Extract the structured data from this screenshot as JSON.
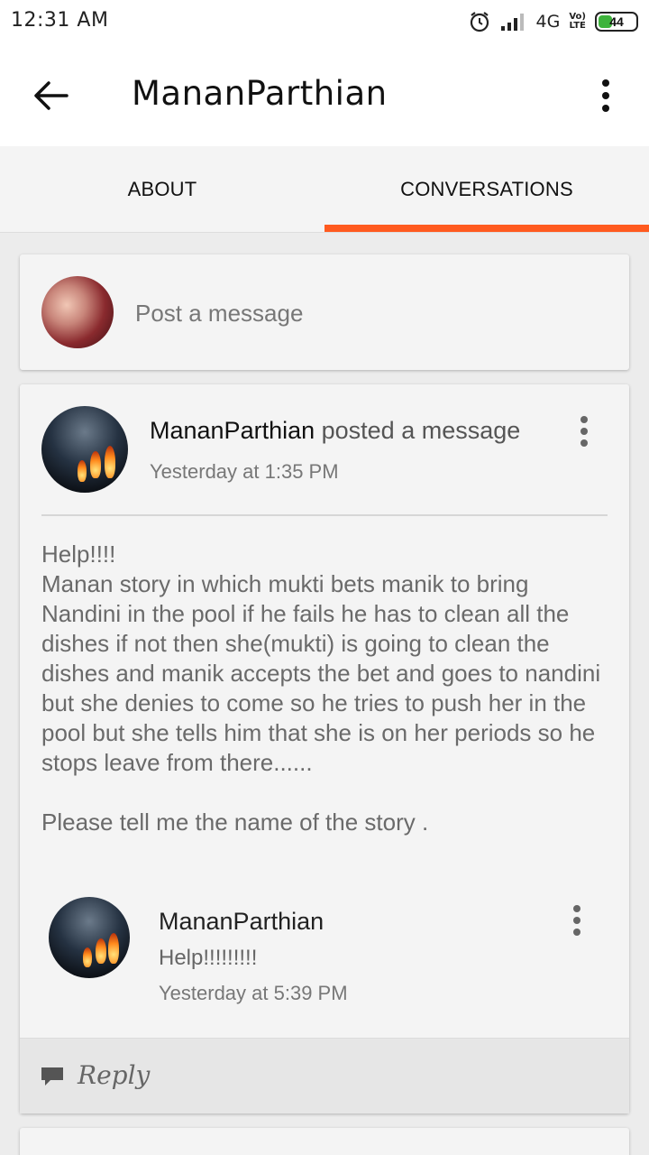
{
  "status_bar": {
    "time": "12:31 AM",
    "network": "4G",
    "network_sub": "Vo)\nLTE",
    "battery": "44",
    "battery_level_percent": 44,
    "icons": [
      "alarm-icon",
      "signal-icon"
    ]
  },
  "app_bar": {
    "title": "MananParthian",
    "back_icon": "arrow-left-icon",
    "menu_icon": "more-vertical-icon"
  },
  "tabs": [
    {
      "label": "ABOUT",
      "active": false
    },
    {
      "label": "CONVERSATIONS",
      "active": true
    }
  ],
  "compose": {
    "placeholder": "Post a message"
  },
  "post": {
    "author": "MananParthian",
    "action": " posted a message",
    "time": "Yesterday at 1:35 PM",
    "body": "Help!!!!\nManan story in which mukti bets manik to bring Nandini in the pool if he fails he has to clean all the dishes if not then she(mukti) is going to clean the dishes and manik accepts the bet and goes to nandini but she denies to come so he tries to push her in the pool but she tells him that she is on her periods so he stops leave from there......\n\nPlease tell me the name of the story .",
    "reply": {
      "author": "MananParthian",
      "text": "Help!!!!!!!!!",
      "time": "Yesterday at 5:39 PM"
    },
    "reply_button": "Reply"
  },
  "colors": {
    "accent": "#ff5a1f",
    "card": "#f4f4f4",
    "battery": "#3db33b"
  }
}
